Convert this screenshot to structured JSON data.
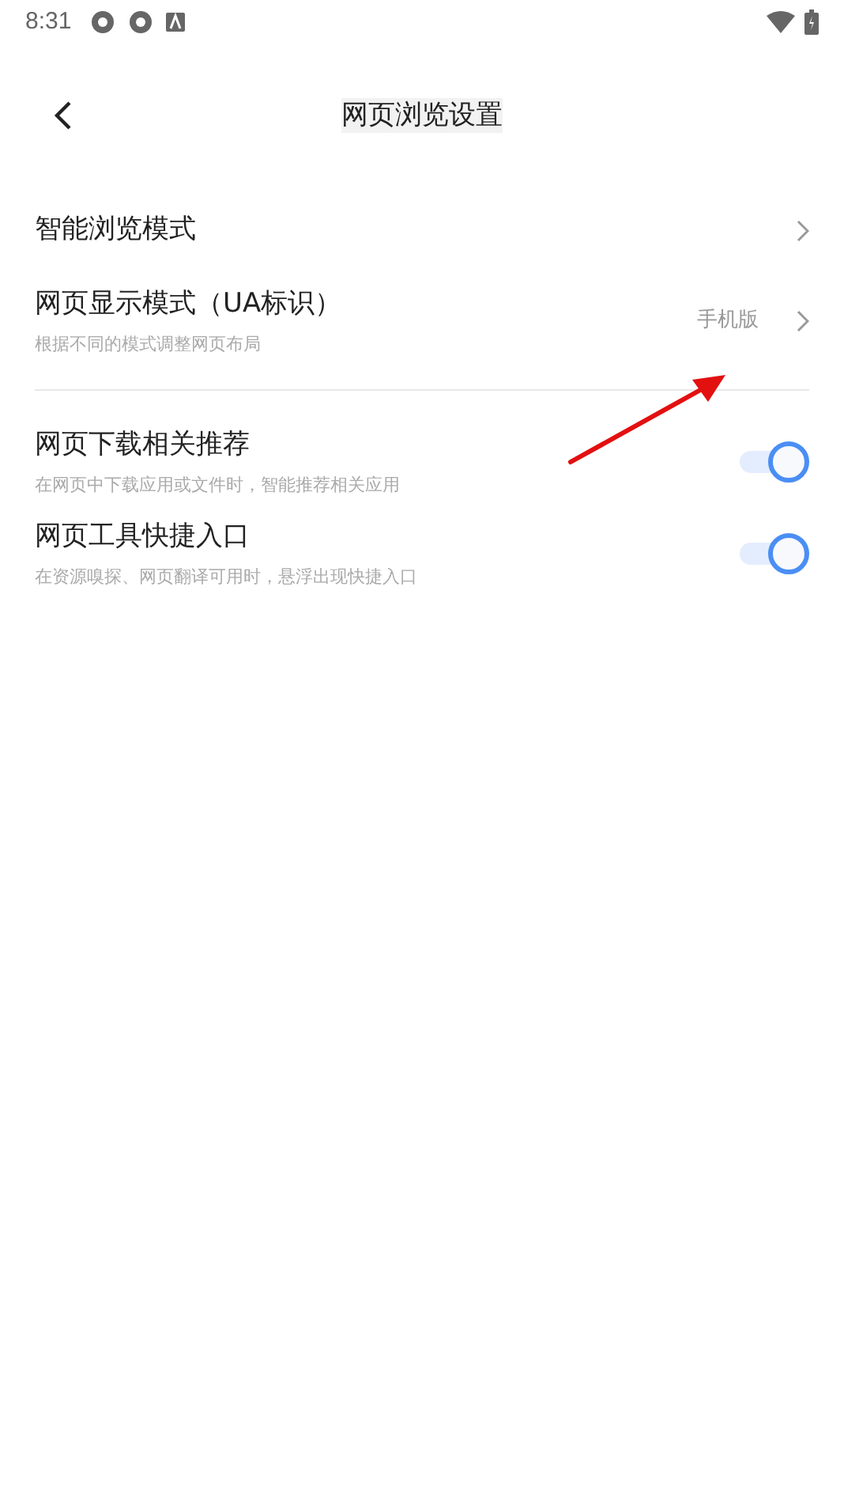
{
  "status_bar": {
    "time": "8:31"
  },
  "header": {
    "title": "网页浏览设置"
  },
  "sections": [
    {
      "items": [
        {
          "kind": "link",
          "title": "智能浏览模式"
        },
        {
          "kind": "link",
          "title": "网页显示模式（UA标识）",
          "subtitle": "根据不同的模式调整网页布局",
          "value": "手机版"
        }
      ]
    },
    {
      "items": [
        {
          "kind": "toggle",
          "title": "网页下载相关推荐",
          "subtitle": "在网页中下载应用或文件时，智能推荐相关应用",
          "on": true
        },
        {
          "kind": "toggle",
          "title": "网页工具快捷入口",
          "subtitle": "在资源嗅探、网页翻译可用时，悬浮出现快捷入口",
          "on": true
        }
      ]
    }
  ]
}
